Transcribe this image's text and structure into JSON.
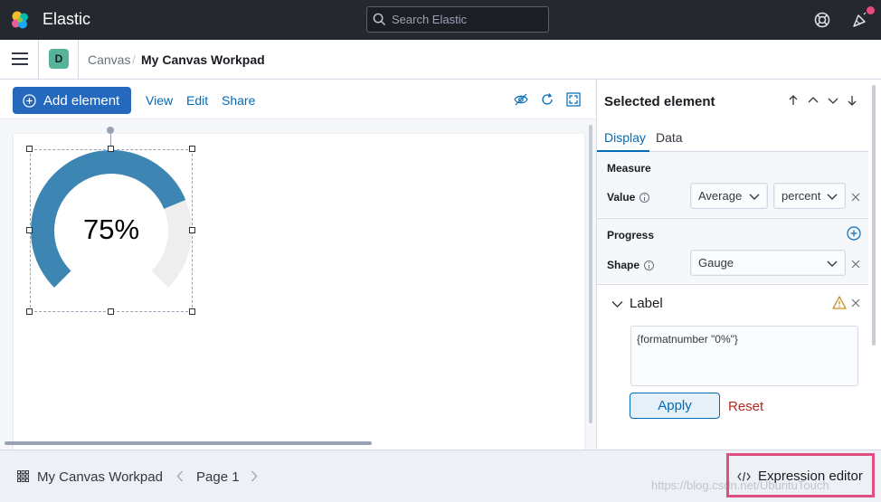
{
  "app": {
    "brand": "Elastic",
    "search_placeholder": "Search Elastic",
    "space_initial": "D"
  },
  "breadcrumb": {
    "parent": "Canvas",
    "separator": "/",
    "current": "My Canvas Workpad"
  },
  "toolbar": {
    "add_element": "Add element",
    "view": "View",
    "edit": "Edit",
    "share": "Share"
  },
  "gauge": {
    "label": "75%",
    "value": 0.75,
    "fill_color": "#3d85b2",
    "track_color": "#eeeeee"
  },
  "sidebar": {
    "title": "Selected element",
    "tabs": [
      "Display",
      "Data"
    ],
    "measure": {
      "heading": "Measure",
      "value_label": "Value",
      "function_select": "Average",
      "field_select": "percent"
    },
    "progress": {
      "heading": "Progress",
      "shape_label": "Shape",
      "shape_select": "Gauge"
    },
    "label": {
      "heading": "Label",
      "expression": "{formatnumber \"0%\"}",
      "apply": "Apply",
      "reset": "Reset"
    }
  },
  "footer": {
    "workpad_name": "My Canvas Workpad",
    "page_label": "Page 1",
    "expression_editor": "Expression editor",
    "watermark": "https://blog.csdn.net/UbuntuTouch"
  },
  "colors": {
    "header_bg": "#25282f",
    "primary": "#2469bd",
    "link": "#006bb8",
    "danger": "#bd271e",
    "highlight": "#df4f82",
    "warning": "#c68c24"
  }
}
